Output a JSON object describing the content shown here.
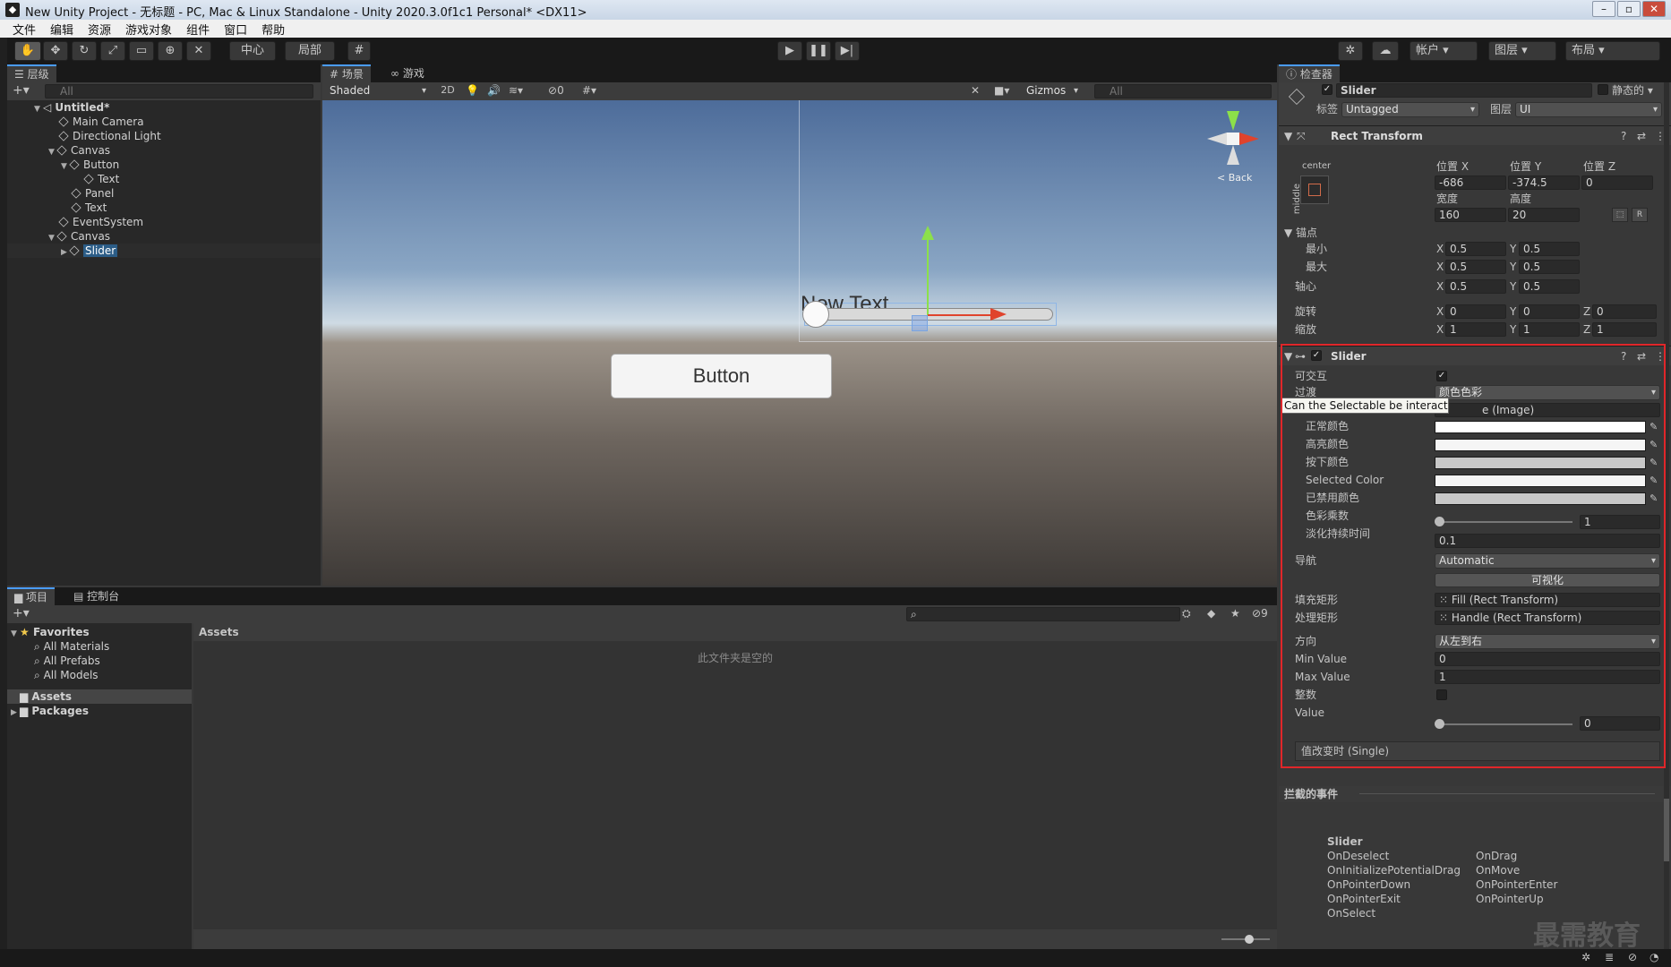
{
  "window": {
    "title": "New Unity Project - 无标题 - PC, Mac & Linux Standalone - Unity 2020.3.0f1c1 Personal* <DX11>"
  },
  "menu": [
    "文件",
    "编辑",
    "资源",
    "游戏对象",
    "组件",
    "窗口",
    "帮助"
  ],
  "toolbar": {
    "pivot": "中心",
    "space": "局部",
    "account": "帐户",
    "layers": "图层",
    "layout": "布局"
  },
  "hierarchy": {
    "tab": "层级",
    "search_placeholder": "All",
    "scene": "Untitled*",
    "items": [
      {
        "label": "Main Camera",
        "depth": 1
      },
      {
        "label": "Directional Light",
        "depth": 1
      },
      {
        "label": "Canvas",
        "depth": 1
      },
      {
        "label": "Button",
        "depth": 2
      },
      {
        "label": "Text",
        "depth": 3
      },
      {
        "label": "Panel",
        "depth": 2
      },
      {
        "label": "Text",
        "depth": 2
      },
      {
        "label": "EventSystem",
        "depth": 1
      },
      {
        "label": "Canvas",
        "depth": 1
      },
      {
        "label": "Slider",
        "depth": 2,
        "selected": true
      }
    ]
  },
  "scene": {
    "tab_scene": "场景",
    "tab_game": "游戏",
    "shading": "Shaded",
    "mode2d": "2D",
    "hidden_count": "0",
    "gizmos": "Gizmos",
    "search_placeholder": "All",
    "back": "Back",
    "new_text": "New Text",
    "button_label": "Button"
  },
  "project": {
    "tab_project": "项目",
    "tab_console": "控制台",
    "favorites": "Favorites",
    "fav_items": [
      "All Materials",
      "All Prefabs",
      "All Models"
    ],
    "assets": "Assets",
    "packages": "Packages",
    "breadcrumb": "Assets",
    "empty": "此文件夹是空的",
    "hidden_count": "9"
  },
  "inspector": {
    "tab": "检查器",
    "object_name": "Slider",
    "static": "静态的",
    "tag_label": "标签",
    "tag": "Untagged",
    "layer_label": "图层",
    "layer": "UI",
    "rect": {
      "title": "Rect Transform",
      "anchor_h": "center",
      "anchor_v": "middle",
      "pos_x_label": "位置 X",
      "pos_y_label": "位置 Y",
      "pos_z_label": "位置 Z",
      "pos_x": "-686",
      "pos_y": "-374.5",
      "pos_z": "0",
      "width_label": "宽度",
      "height_label": "高度",
      "width": "160",
      "height": "20",
      "anchors": "锚点",
      "min": "最小",
      "max": "最大",
      "min_x": "0.5",
      "min_y": "0.5",
      "max_x": "0.5",
      "max_y": "0.5",
      "pivot": "轴心",
      "pivot_x": "0.5",
      "pivot_y": "0.5",
      "rotation": "旋转",
      "rot_x": "0",
      "rot_y": "0",
      "rot_z": "0",
      "scale": "缩放",
      "scale_x": "1",
      "scale_y": "1",
      "scale_z": "1",
      "x": "X",
      "y": "Y",
      "z": "Z"
    },
    "slider": {
      "title": "Slider",
      "interactable": "可交互",
      "transition": "过渡",
      "transition_value": "颜色色彩",
      "tooltip": "Can the Selectable be interacted with?",
      "target_value": "e (Image)",
      "normal": "正常颜色",
      "highlighted": "高亮颜色",
      "pressed": "按下颜色",
      "selected": "Selected Color",
      "disabled": "已禁用颜色",
      "multiplier": "色彩乘数",
      "multiplier_value": "1",
      "fade": "淡化持续时间",
      "fade_value": "0.1",
      "navigation": "导航",
      "navigation_value": "Automatic",
      "visualize": "可视化",
      "fill_rect": "填充矩形",
      "fill_rect_value": "Fill (Rect Transform)",
      "handle_rect": "处理矩形",
      "handle_rect_value": "Handle (Rect Transform)",
      "direction": "方向",
      "direction_value": "从左到右",
      "min_value": "Min Value",
      "min_value_v": "0",
      "max_value": "Max Value",
      "max_value_v": "1",
      "whole": "整数",
      "value": "Value",
      "value_v": "0",
      "on_change": "值改变时 (Single)"
    },
    "events": {
      "title": "拦截的事件",
      "component": "Slider",
      "col1": [
        "OnDeselect",
        "OnInitializePotentialDrag",
        "OnPointerDown",
        "OnPointerExit",
        "OnSelect"
      ],
      "col2": [
        "OnDrag",
        "OnMove",
        "OnPointerEnter",
        "OnPointerUp"
      ]
    }
  },
  "watermark": "最需教育",
  "colors": {
    "accent": "#4a9cff",
    "highlight_box": "#e0262a",
    "selection": "#2c5d87"
  }
}
